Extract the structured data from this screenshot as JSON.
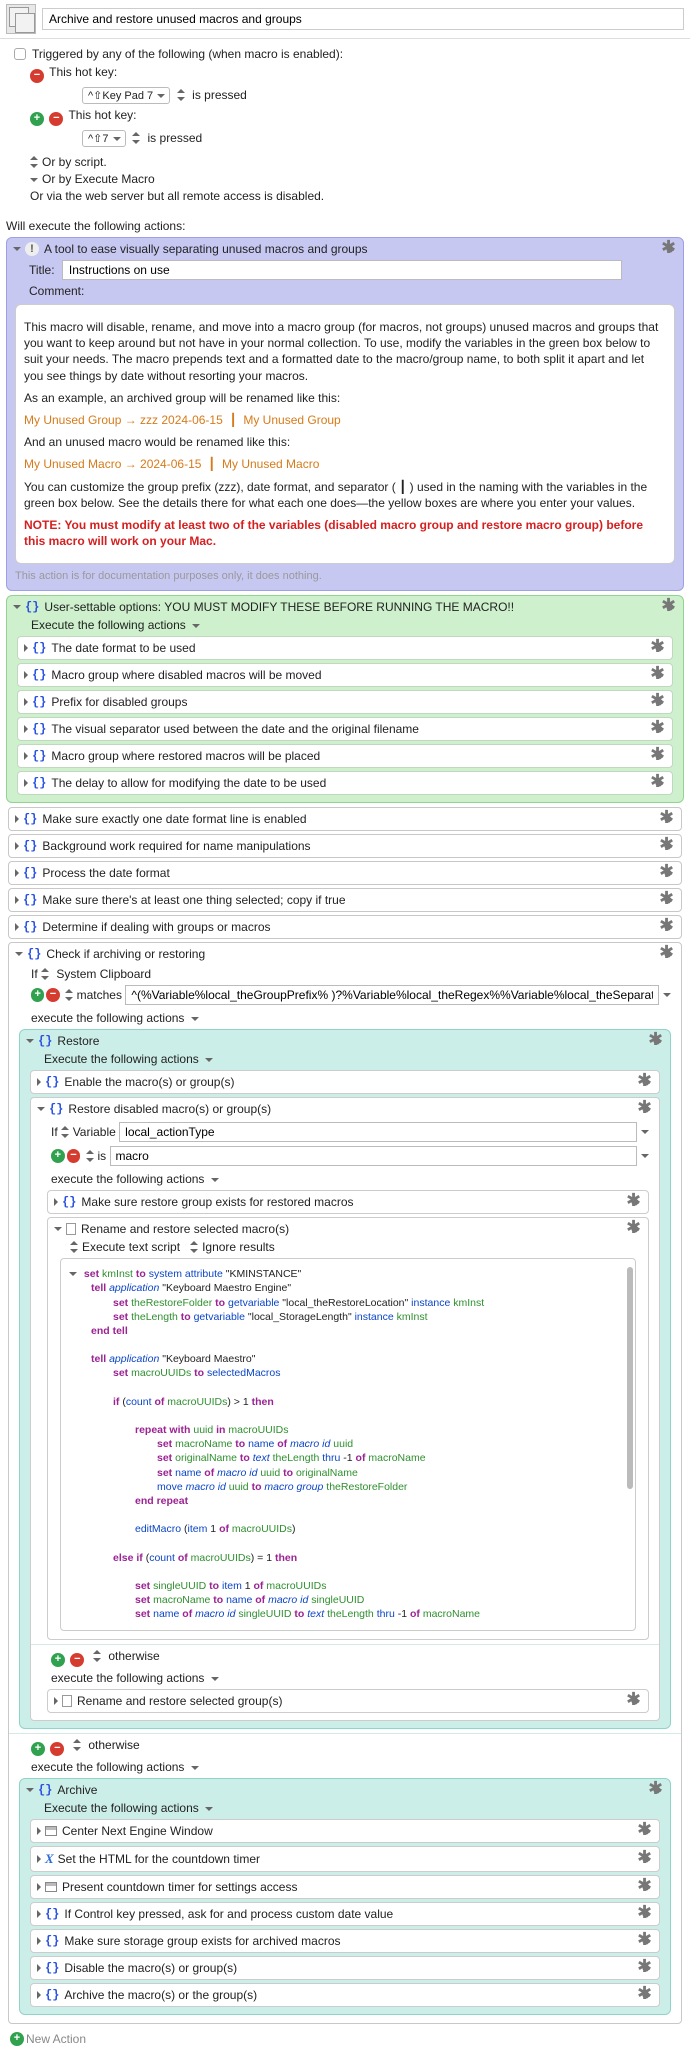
{
  "title": "Archive and restore unused macros and groups",
  "trigger_header": "Triggered by any of the following (when macro is enabled):",
  "hotkey_label": "This hot key:",
  "hk1_key": "^⇧Key Pad 7",
  "hk2_key": "^⇧7",
  "hk_state": "is pressed",
  "or_script": "Or by script.",
  "or_exec": "Or by Execute Macro",
  "or_web": "Or via the web server but all remote access is disabled.",
  "will_exec": "Will execute the following actions:",
  "purple": {
    "title": "A tool to ease visually separating unused macros and groups",
    "title_label": "Title:",
    "title_value": "Instructions on use",
    "comment_label": "Comment:",
    "p1": "This macro will disable, rename, and move into a macro group (for macros, not groups) unused macros and groups that you want to keep around but not have in your normal collection. To use, modify the variables in the green box below to suit your needs. The macro prepends text and a formatted date to the macro/group name, to both split it apart and let you see things by date without resorting your macros.",
    "p2": "As an example, an archived group will be renamed like this:",
    "ex1a": "My Unused Group → zzz 2024-06-15",
    "ex1b": "My Unused Group",
    "p3": "And an unused macro would be renamed like this:",
    "ex2a": "My Unused Macro → 2024-06-15",
    "ex2b": "My Unused Macro",
    "p4a": "You can customize the group prefix (zzz), date format, and separator (",
    "p4b": ") used in the naming with the variables in the green box below. See the details there for what each one does—the yellow boxes are where you enter your values.",
    "note": "NOTE: You must modify at least two of the variables (disabled macro group and restore macro group) before this macro will work on your Mac.",
    "foot": "This action is for documentation purposes only, it does nothing."
  },
  "green": {
    "title": "User-settable options: YOU MUST MODIFY THESE BEFORE RUNNING THE MACRO!!",
    "exec": "Execute the following actions",
    "rows": [
      "The date format to be used",
      "Macro group where disabled macros will be moved",
      "Prefix for disabled groups",
      "The visual separator used between the date and the original filename",
      "Macro group where restored macros will be placed",
      "The delay to allow for modifying the date to be used"
    ]
  },
  "grey_rows": [
    "Make sure exactly one date format line is enabled",
    "Background work required for name manipulations",
    "Process the date format",
    "Make sure there's at least one thing selected; copy if true",
    "Determine if dealing with groups or macros"
  ],
  "check": {
    "title": "Check if archiving or restoring",
    "if_label": "If",
    "if_src": "System Clipboard",
    "matches_label": "matches",
    "matches_val": "^(%Variable%local_theGroupPrefix% )?%Variable%local_theRegex%%Variable%local_theSeparator%.*",
    "exec": "execute the following actions"
  },
  "restore": {
    "title": "Restore",
    "exec": "Execute the following actions",
    "enable_row": "Enable the macro(s) or group(s)",
    "r2_title": "Restore disabled macro(s) or group(s)",
    "if_label": "If",
    "var_label": "Variable",
    "var_name": "local_actionType",
    "is_label": "is",
    "is_val": "macro",
    "exec2": "execute the following actions",
    "sub1": "Make sure restore group exists for restored macros",
    "sub2": "Rename and restore selected macro(s)",
    "script_opts1": "Execute text script",
    "script_opts2": "Ignore results",
    "otherwise": "otherwise",
    "exec3": "execute the following actions",
    "sub3": "Rename and restore selected group(s)"
  },
  "script": {
    "l1_set": "set",
    "l1_km": "kmInst",
    "l1_to": "to",
    "l1_sys": "system attribute",
    "l1_str": "\"KMINSTANCE\"",
    "l2_tell": "tell",
    "l2_app": "application",
    "l2_str": "\"Keyboard Maestro Engine\"",
    "l3_set": "set",
    "l3_var": "theRestoreFolder",
    "l3_to": "to",
    "l3_gv": "getvariable",
    "l3_str": "\"local_theRestoreLocation\"",
    "l3_inst": "instance",
    "l3_km": "kmInst",
    "l4_set": "set",
    "l4_var": "theLength",
    "l4_to": "to",
    "l4_gv": "getvariable",
    "l4_str": "\"local_StorageLength\"",
    "l4_inst": "instance",
    "l4_km": "kmInst",
    "l5": "end tell",
    "l6_tell": "tell",
    "l6_app": "application",
    "l6_str": "\"Keyboard Maestro\"",
    "l7_set": "set",
    "l7_var": "macroUUIDs",
    "l7_to": "to",
    "l7_sel": "selectedMacros",
    "l8_if": "if",
    "l8_a": "(",
    "l8_cnt": "count",
    "l8_of": "of",
    "l8_v": "macroUUIDs",
    "l8_b": ") > 1",
    "l8_then": "then",
    "l9_rep": "repeat with",
    "l9_u": "uuid",
    "l9_in": "in",
    "l9_v": "macroUUIDs",
    "l10_set": "set",
    "l10_v": "macroName",
    "l10_to": "to",
    "l10_name": "name",
    "l10_of": "of",
    "l10_mid": "macro id",
    "l10_u": "uuid",
    "l11_set": "set",
    "l11_v": "originalName",
    "l11_to": "to",
    "l11_txt": "text",
    "l11_len": "theLength",
    "l11_thru": "thru",
    "l11_neg": "-1",
    "l11_of": "of",
    "l11_mn": "macroName",
    "l12_set": "set",
    "l12_name": "name",
    "l12_of": "of",
    "l12_mid": "macro id",
    "l12_u": "uuid",
    "l12_to": "to",
    "l12_on": "originalName",
    "l13_mv": "move",
    "l13_mid": "macro id",
    "l13_u": "uuid",
    "l13_to": "to",
    "l13_mg": "macro group",
    "l13_rf": "theRestoreFolder",
    "l14": "end repeat",
    "l15_em": "editMacro",
    "l15_a": "(",
    "l15_it": "item",
    "l15_n": "1",
    "l15_of": "of",
    "l15_v": "macroUUIDs",
    "l15_b": ")",
    "l16_else": "else if",
    "l16_a": "(",
    "l16_cnt": "count",
    "l16_of": "of",
    "l16_v": "macroUUIDs",
    "l16_b": ") = 1",
    "l16_then": "then",
    "l17_set": "set",
    "l17_v": "singleUUID",
    "l17_to": "to",
    "l17_it": "item",
    "l17_n": "1",
    "l17_of": "of",
    "l17_mu": "macroUUIDs",
    "l18_set": "set",
    "l18_v": "macroName",
    "l18_to": "to",
    "l18_name": "name",
    "l18_of": "of",
    "l18_mid": "macro id",
    "l18_su": "singleUUID",
    "l19_set": "set",
    "l19_name": "name",
    "l19_of": "of",
    "l19_mid": "macro id",
    "l19_su": "singleUUID",
    "l19_to": "to",
    "l19_txt": "text",
    "l19_len": "theLength",
    "l19_thru": "thru",
    "l19_neg": "-1",
    "l19_of2": "of",
    "l19_mn": "macroName"
  },
  "otherwise2": "otherwise",
  "exec_again": "execute the following actions",
  "archive": {
    "title": "Archive",
    "exec": "Execute the following actions",
    "rows": [
      "Center Next Engine Window",
      "Set the HTML for the countdown timer",
      "Present countdown timer for settings access",
      "If Control key pressed, ask for and process custom date value",
      "Make sure storage group exists for archived macros",
      "Disable the macro(s) or group(s)",
      "Archive the macro(s) or the group(s)"
    ]
  },
  "new_action": "New Action",
  "sep_pipe": "┃"
}
